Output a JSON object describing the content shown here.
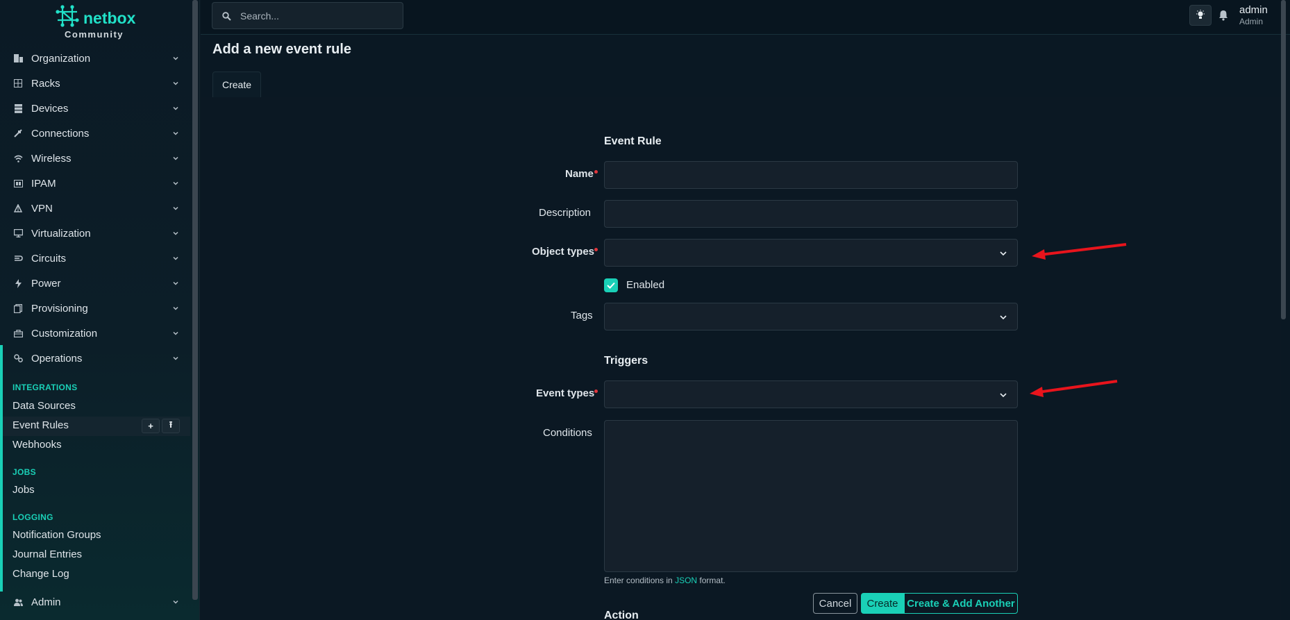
{
  "brand": {
    "name": "netbox",
    "edition": "Community"
  },
  "sidebar": {
    "items": [
      {
        "label": "Organization",
        "icon": "building-icon"
      },
      {
        "label": "Racks",
        "icon": "rack-icon"
      },
      {
        "label": "Devices",
        "icon": "server-icon"
      },
      {
        "label": "Connections",
        "icon": "plug-icon"
      },
      {
        "label": "Wireless",
        "icon": "wifi-icon"
      },
      {
        "label": "IPAM",
        "icon": "ip-icon"
      },
      {
        "label": "VPN",
        "icon": "vpn-icon"
      },
      {
        "label": "Virtualization",
        "icon": "monitor-icon"
      },
      {
        "label": "Circuits",
        "icon": "circuit-icon"
      },
      {
        "label": "Power",
        "icon": "lightning-icon"
      },
      {
        "label": "Provisioning",
        "icon": "files-icon"
      },
      {
        "label": "Customization",
        "icon": "toolbox-icon"
      },
      {
        "label": "Operations",
        "icon": "cogs-icon"
      }
    ],
    "operations": {
      "integrations_header": "INTEGRATIONS",
      "data_sources": "Data Sources",
      "event_rules": "Event Rules",
      "webhooks": "Webhooks",
      "jobs_header": "JOBS",
      "jobs": "Jobs",
      "logging_header": "LOGGING",
      "notification_groups": "Notification Groups",
      "journal_entries": "Journal Entries",
      "change_log": "Change Log"
    },
    "admin": {
      "label": "Admin",
      "icon": "users-icon"
    },
    "add_glyph": "+",
    "import_glyph": "⭱"
  },
  "header": {
    "search_placeholder": "Search...",
    "user_name": "admin",
    "user_role": "Admin"
  },
  "page": {
    "title": "Add a new event rule",
    "tab": "Create"
  },
  "form": {
    "section_event_rule": "Event Rule",
    "name_label": "Name",
    "description_label": "Description",
    "object_types_label": "Object types",
    "enabled_label": "Enabled",
    "enabled_checked": true,
    "tags_label": "Tags",
    "section_triggers": "Triggers",
    "event_types_label": "Event types",
    "conditions_label": "Conditions",
    "conditions_help_prefix": "Enter conditions in ",
    "conditions_help_link": "JSON",
    "conditions_help_suffix": " format.",
    "section_action": "Action"
  },
  "buttons": {
    "cancel": "Cancel",
    "create": "Create",
    "create_another": "Create & Add Another"
  },
  "colors": {
    "accent": "#1ad0b7",
    "required": "#e0363c",
    "annotation_arrow": "#e8141c",
    "background": "#0a1823"
  }
}
